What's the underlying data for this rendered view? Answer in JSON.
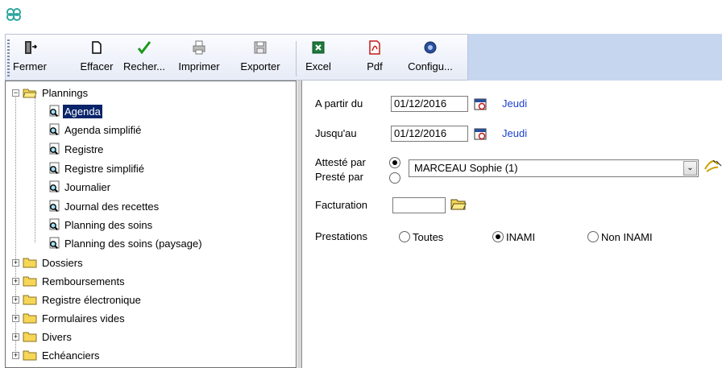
{
  "toolbar": {
    "buttons": [
      {
        "id": "fermer",
        "label": "Fermer",
        "icon": "exit-door-icon"
      },
      {
        "id": "effacer",
        "label": "Effacer",
        "icon": "blank-page-icon"
      },
      {
        "id": "rechercher",
        "label": "Recher...",
        "icon": "checkmark-icon"
      },
      {
        "id": "imprimer",
        "label": "Imprimer",
        "icon": "printer-icon"
      },
      {
        "id": "exporter",
        "label": "Exporter",
        "icon": "save-disk-icon"
      },
      {
        "id": "excel",
        "label": "Excel",
        "icon": "excel-icon"
      },
      {
        "id": "pdf",
        "label": "Pdf",
        "icon": "pdf-icon"
      },
      {
        "id": "configurer",
        "label": "Configu...",
        "icon": "gear-icon"
      }
    ]
  },
  "tree": {
    "root": {
      "label": "Plannings",
      "expander": "−"
    },
    "children": [
      "Agenda",
      "Agenda simplifié",
      "Registre",
      "Registre simplifié",
      "Journalier",
      "Journal des recettes",
      "Planning des soins",
      "Planning des soins (paysage)"
    ],
    "selected_index": 0,
    "folders": [
      "Dossiers",
      "Remboursements",
      "Registre électronique",
      "Formulaires vides",
      "Divers",
      "Echéanciers"
    ],
    "folder_expander": "+"
  },
  "form": {
    "from_label": "A partir du",
    "from_date": "01/12/2016",
    "from_day": "Jeudi",
    "to_label": "Jusqu'au",
    "to_date": "01/12/2016",
    "to_day": "Jeudi",
    "attested_label": "Attesté par",
    "performed_label": "Presté par",
    "practitioner": "MARCEAU Sophie (1)",
    "select_arrow": "⌄",
    "billing_label": "Facturation",
    "billing_value": "",
    "services_label": "Prestations",
    "services_options": [
      "Toutes",
      "INAMI",
      "Non INAMI"
    ],
    "services_selected": 1
  },
  "colors": {
    "selection": "#0a246a",
    "link": "#1c3fd0",
    "toolbar_bg": "#c6d6ef"
  }
}
